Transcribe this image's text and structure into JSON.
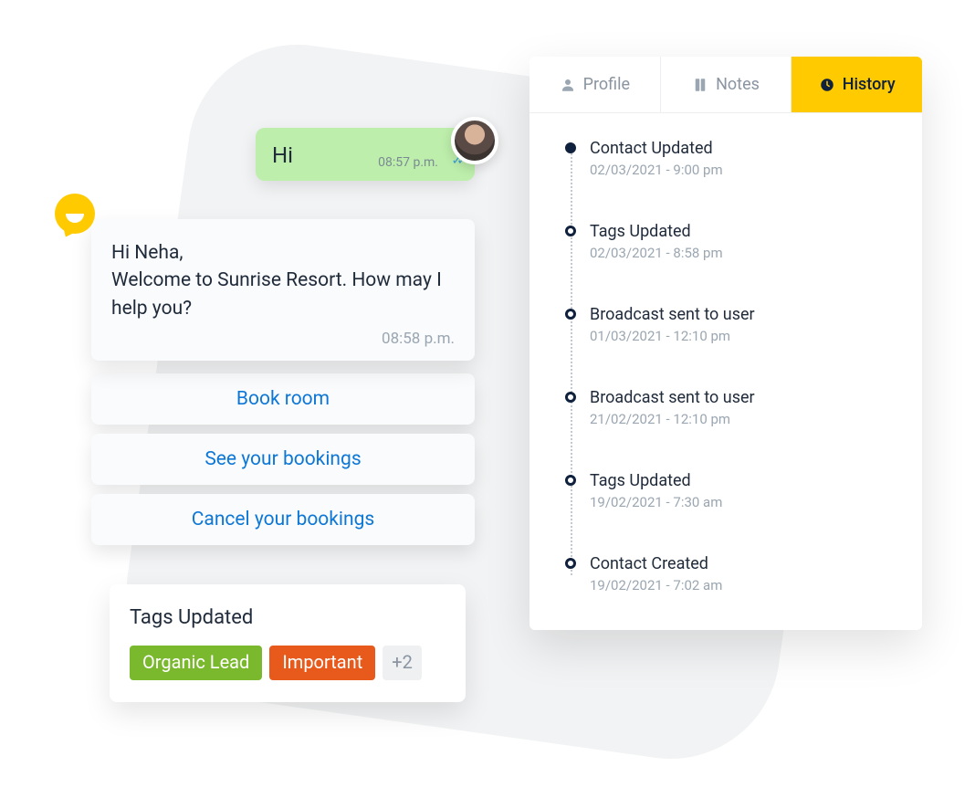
{
  "chat": {
    "incoming": {
      "text": "Hi",
      "time": "08:57 p.m."
    },
    "outgoing": {
      "text": "Hi Neha,\nWelcome to Sunrise Resort. How may I help you?",
      "time": "08:58 p.m."
    },
    "quick_replies": [
      "Book room",
      "See your bookings",
      "Cancel your bookings"
    ]
  },
  "tags_card": {
    "title": "Tags Updated",
    "tags": [
      "Organic Lead",
      "Important"
    ],
    "more": "+2"
  },
  "panel": {
    "tabs": {
      "profile": "Profile",
      "notes": "Notes",
      "history": "History",
      "active": "history"
    },
    "timeline": [
      {
        "title": "Contact Updated",
        "time": "02/03/2021 - 9:00 pm"
      },
      {
        "title": "Tags Updated",
        "time": "02/03/2021 - 8:58 pm"
      },
      {
        "title": "Broadcast sent to user",
        "time": "01/03/2021 - 12:10 pm"
      },
      {
        "title": "Broadcast sent to user",
        "time": "21/02/2021 - 12:10 pm"
      },
      {
        "title": "Tags Updated",
        "time": "19/02/2021 - 7:30 am"
      },
      {
        "title": "Contact Created",
        "time": "19/02/2021 - 7:02 am"
      }
    ]
  }
}
